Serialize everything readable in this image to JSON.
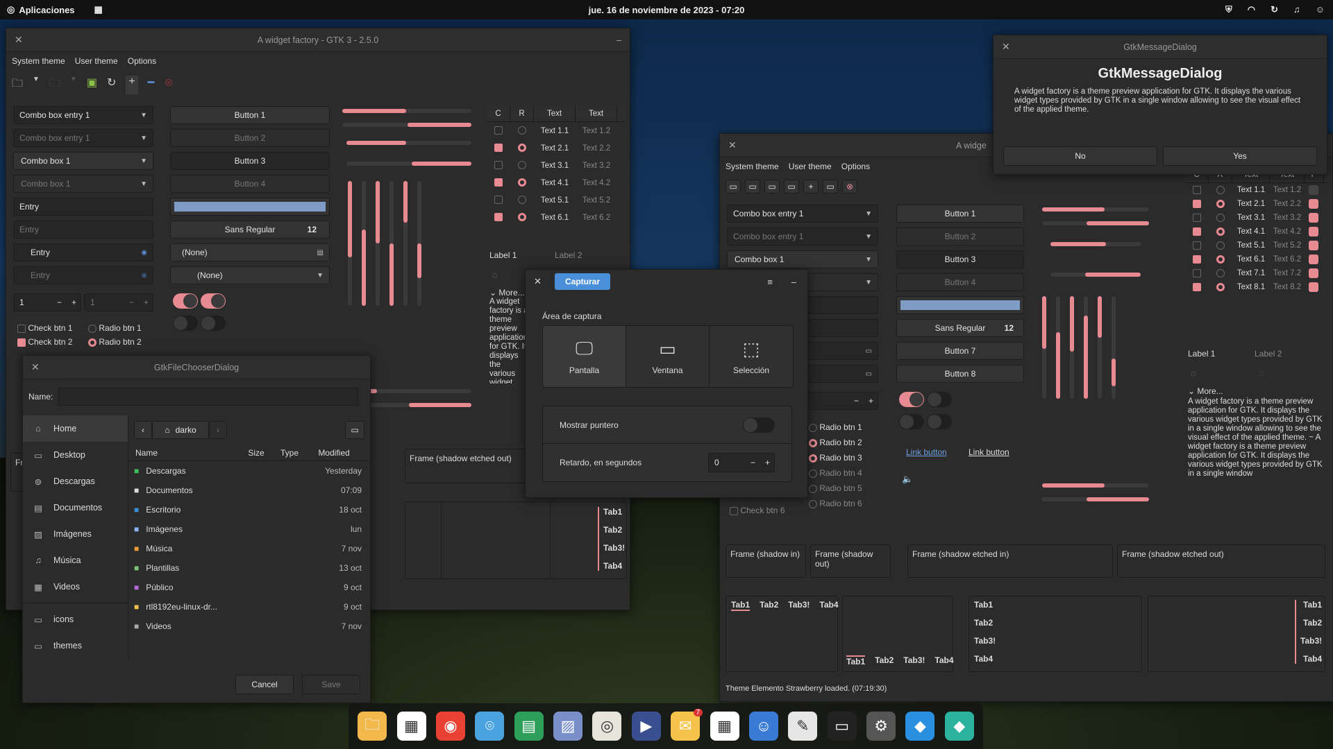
{
  "topbar": {
    "apps_label": "Aplicaciones",
    "clock": "jue. 16 de noviembre de 2023 - 07:20"
  },
  "factory_back": {
    "title": "A widget factory - GTK 3 - 2.5.0",
    "menu": [
      "System theme",
      "User theme",
      "Options"
    ],
    "combos": [
      "Combo box entry 1",
      "Combo box entry 1",
      "Combo box 1",
      "Combo box 1"
    ],
    "entries": [
      "Entry",
      "Entry",
      "Entry",
      "Entry"
    ],
    "spin1": "1",
    "spin2": "1",
    "buttons": [
      "Button 1",
      "Button 2",
      "Button 3",
      "Button 4"
    ],
    "font_name": "Sans Regular",
    "font_size": "12",
    "none1": "(None)",
    "none2": "(None)",
    "checks": [
      "Check btn 1",
      "Check btn 2"
    ],
    "radios": [
      "Radio btn 1",
      "Radio btn 2"
    ],
    "table_headers": [
      "C",
      "R",
      "Text",
      "Text"
    ],
    "table_rows": [
      {
        "a": "Text 1.1",
        "b": "Text 1.2",
        "c": false,
        "r": false
      },
      {
        "a": "Text 2.1",
        "b": "Text 2.2",
        "c": true,
        "r": true
      },
      {
        "a": "Text 3.1",
        "b": "Text 3.2",
        "c": false,
        "r": false
      },
      {
        "a": "Text 4.1",
        "b": "Text 4.2",
        "c": true,
        "r": true
      },
      {
        "a": "Text 5.1",
        "b": "Text 5.2",
        "c": false,
        "r": false
      },
      {
        "a": "Text 6.1",
        "b": "Text 6.2",
        "c": true,
        "r": true
      }
    ],
    "label1": "Label 1",
    "label2": "Label 2",
    "more": "More...",
    "more_text": "A widget factory is a theme preview application for GTK. It displays the various widget types provided by GTK in a single window allowing to see the visual effect of the applied theme. ~ A widget factory is a theme preview application for GTK. It displays the various widget types provided by",
    "frame_etched_out": "Frame (shadow etched out)",
    "frame_fr": "Fr",
    "tabs": [
      "Tab1",
      "Tab2",
      "Tab3!",
      "Tab4"
    ]
  },
  "filechooser": {
    "title": "GtkFileChooserDialog",
    "name_label": "Name:",
    "places": [
      "Home",
      "Desktop",
      "Descargas",
      "Documentos",
      "Imágenes",
      "Música",
      "Videos",
      "icons",
      "themes"
    ],
    "path": "darko",
    "cols": [
      "Name",
      "Size",
      "Type",
      "Modified"
    ],
    "files": [
      {
        "n": "Descargas",
        "m": "Yesterday",
        "c": "#3fbf5a"
      },
      {
        "n": "Documentos",
        "m": "07:09",
        "c": "#dddddd"
      },
      {
        "n": "Escritorio",
        "m": "18 oct",
        "c": "#3a8fd9"
      },
      {
        "n": "Imágenes",
        "m": "lun",
        "c": "#8ab4f8"
      },
      {
        "n": "Música",
        "m": "7 nov",
        "c": "#f29b38"
      },
      {
        "n": "Plantillas",
        "m": "13 oct",
        "c": "#7bc67b"
      },
      {
        "n": "Público",
        "m": "9 oct",
        "c": "#b46ad6"
      },
      {
        "n": "rtl8192eu-linux-dr...",
        "m": "9 oct",
        "c": "#f2c14e"
      },
      {
        "n": "Videos",
        "m": "7 nov",
        "c": "#aaaaaa"
      }
    ],
    "cancel": "Cancel",
    "save": "Save"
  },
  "capture": {
    "button": "Capturar",
    "area_label": "Área de captura",
    "modes": [
      "Pantalla",
      "Ventana",
      "Selección"
    ],
    "pointer_label": "Mostrar puntero",
    "delay_label": "Retardo, en segundos",
    "delay_value": "0"
  },
  "message_dialog": {
    "title": "GtkMessageDialog",
    "heading": "GtkMessageDialog",
    "body": "A widget factory is a theme preview application for GTK. It displays the various widget types provided by GTK in a single window allowing to see the visual effect of the applied theme.",
    "no": "No",
    "yes": "Yes"
  },
  "factory_front": {
    "title": "A widge",
    "menu": [
      "System theme",
      "User theme",
      "Options"
    ],
    "combos": [
      "Combo box entry 1",
      "Combo box entry 1",
      "Combo box 1"
    ],
    "spin": "1",
    "buttons": [
      "Button 1",
      "Button 2",
      "Button 3",
      "Button 4",
      "Button 7",
      "Button 8"
    ],
    "font_name": "Sans Regular",
    "font_size": "12",
    "radios": [
      "Radio btn 1",
      "Radio btn 2",
      "Radio btn 3",
      "Radio btn 4",
      "Radio btn 5",
      "Radio btn 6"
    ],
    "check6": "Check btn 6",
    "links": [
      "Link button",
      "Link button"
    ],
    "table_headers": [
      "C",
      "R",
      "Text",
      "Text",
      "P"
    ],
    "table_rows": [
      {
        "a": "Text 1.1",
        "b": "Text 1.2",
        "c": false,
        "r": false
      },
      {
        "a": "Text 2.1",
        "b": "Text 2.2",
        "c": true,
        "r": true
      },
      {
        "a": "Text 3.1",
        "b": "Text 3.2",
        "c": false,
        "r": false
      },
      {
        "a": "Text 4.1",
        "b": "Text 4.2",
        "c": true,
        "r": true
      },
      {
        "a": "Text 5.1",
        "b": "Text 5.2",
        "c": false,
        "r": false
      },
      {
        "a": "Text 6.1",
        "b": "Text 6.2",
        "c": true,
        "r": true
      },
      {
        "a": "Text 7.1",
        "b": "Text 7.2",
        "c": false,
        "r": false
      },
      {
        "a": "Text 8.1",
        "b": "Text 8.2",
        "c": true,
        "r": true
      }
    ],
    "label1": "Label 1",
    "label2": "Label 2",
    "more": "More...",
    "more_text": "A widget factory is a theme preview application for GTK. It displays the various widget types provided by GTK in a single window allowing to see the visual effect of the applied theme. ~ A widget factory is a theme preview application for GTK. It displays the various widget types provided by GTK in a single window",
    "frames": [
      "Frame (shadow in)",
      "Frame (shadow out)",
      "Frame (shadow etched in)",
      "Frame (shadow etched out)"
    ],
    "tabs": [
      "Tab1",
      "Tab2",
      "Tab3!",
      "Tab4"
    ],
    "status": "Theme Elemento Strawberry loaded.   (07:19:30)"
  },
  "dock": {
    "icons": [
      "folder-icon",
      "store-icon",
      "chrome-icon",
      "screenshot-icon",
      "spreadsheet-icon",
      "image-viewer-icon",
      "speaker-icon",
      "video-player-icon",
      "mail-icon",
      "calendar-icon",
      "contacts-icon",
      "text-editor-icon",
      "terminal-icon",
      "settings-icon",
      "vscode-icon",
      "vscode-insiders-icon"
    ],
    "mail_badge": "7"
  }
}
